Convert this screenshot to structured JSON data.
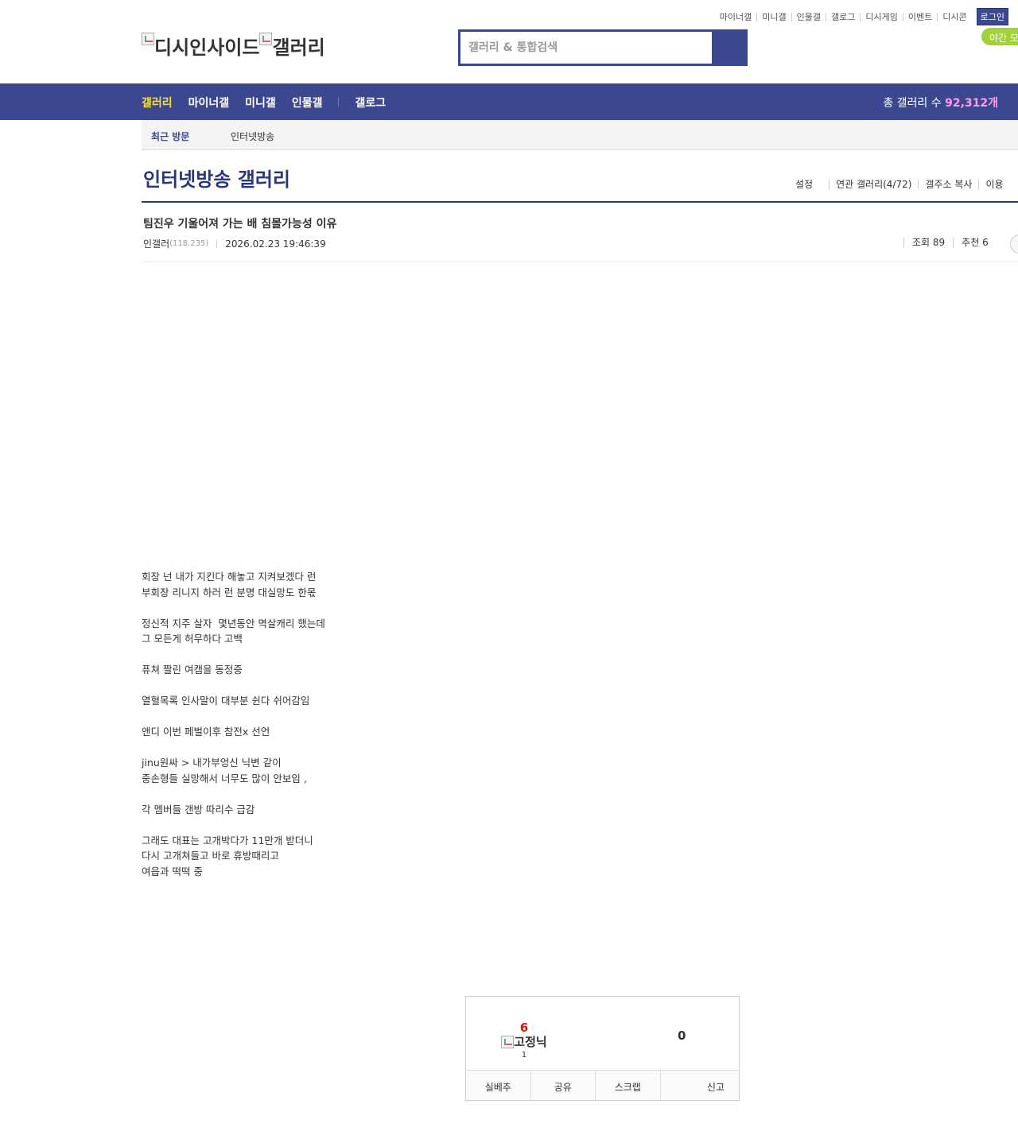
{
  "util_links": [
    "마이너갤",
    "미니갤",
    "인물갤",
    "갤로그",
    "디시게임",
    "이벤트",
    "디시콘"
  ],
  "login_label": "로그인",
  "night_mode_label": "야간 모드",
  "logo": {
    "alt1": "디시인사이드",
    "alt2": "갤러리"
  },
  "search": {
    "placeholder": "갤러리 & 통합검색"
  },
  "gnb": {
    "items": [
      "갤러리",
      "마이너갤",
      "미니갤",
      "인물갤",
      "갤로그"
    ],
    "total_label": "총 갤러리 수",
    "total_count": "92,312개"
  },
  "recent": {
    "label": "최근 방문",
    "items": [
      "인터넷방송"
    ]
  },
  "gallery": {
    "title": "인터넷방송 갤러리",
    "options": [
      "설정",
      "연관 갤러리(4/72)",
      "갤주소 복사",
      "이용"
    ]
  },
  "post": {
    "title": "팀진우 기울어져 가는 배 침몰가능성 이유",
    "author": "인갤러",
    "ip": "(118.235)",
    "date": "2026.02.23 19:46:39",
    "views_label": "조회 89",
    "recommend_label": "추천 6",
    "body": [
      "회장 넌 내가 지킨다 해놓고 지켜보겠다 런",
      "부회장 리니지 하러 런 분명 대실망도 한몫",
      "",
      "정신적 지주 살자  몇년동안 멱살캐리 했는데",
      "그 모든게 허무하다 고백",
      "",
      "퓨쳐 짤린 여캠을 동정중",
      "",
      "열혈목록 인사말이 대부분 쉰다 쉬어감임",
      "",
      "앤디 이번 페벌이후 참전x 선언",
      "",
      "jinu원싸 > 내가부엉신 닉변 같이",
      "중손형들 실망해서 너무도 많이 안보임 ,",
      "",
      "각 멤버들 갠방 따리수 급감",
      "",
      "그래도 대표는 고개박다가 11만개 받더니",
      "다시 고개쳐들고 바로 휴방때리고",
      "여읍과 떡떡 중"
    ]
  },
  "vote": {
    "up_count": "6",
    "nick_alt": "고정닉",
    "fixed_count": "1",
    "down_count": "0",
    "buttons": [
      "실베추",
      "공유",
      "스크랩",
      "신고"
    ]
  }
}
